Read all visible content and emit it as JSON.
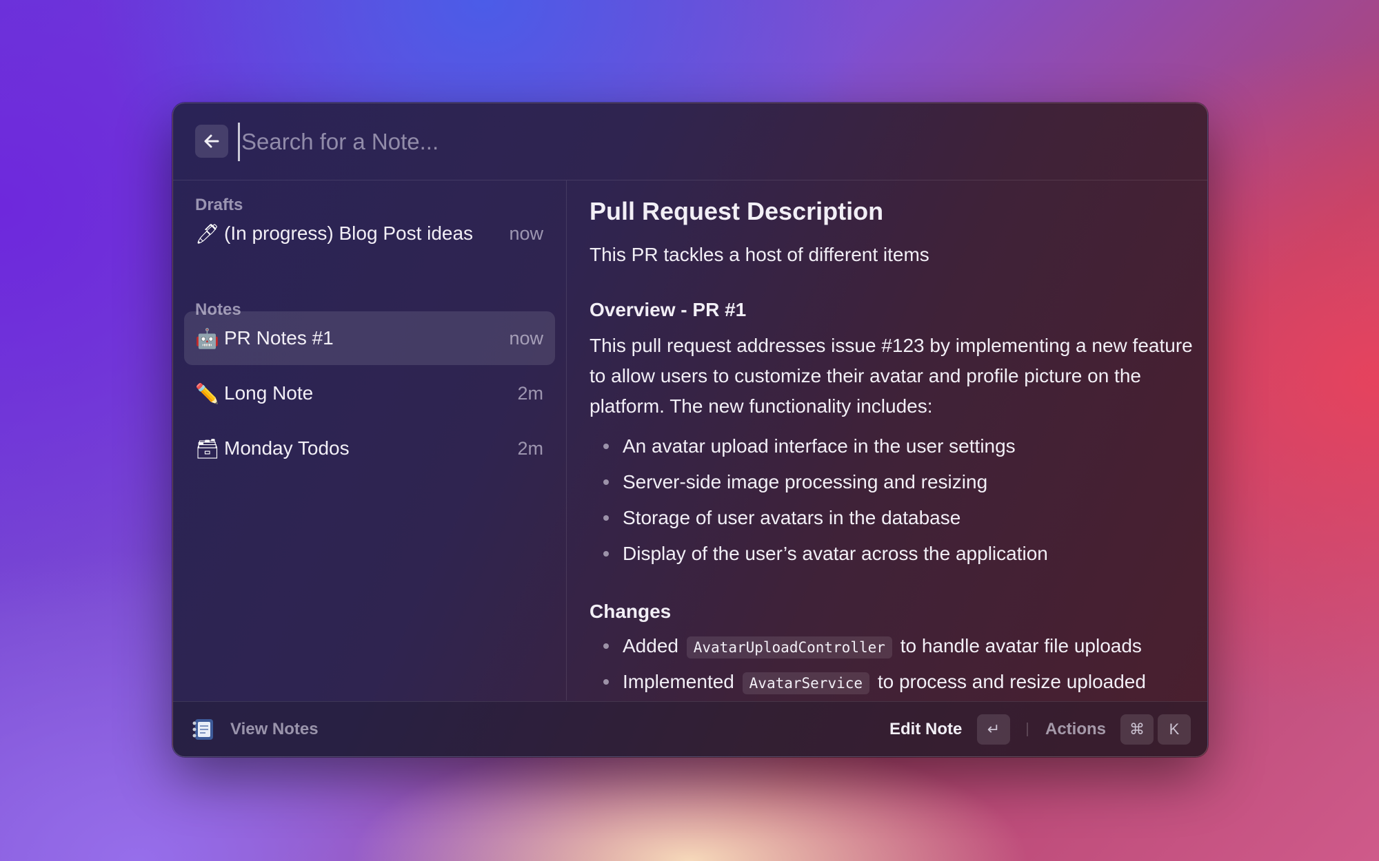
{
  "search": {
    "placeholder": "Search for a Note...",
    "back_icon": "arrow-left-icon"
  },
  "sidebar": {
    "drafts_label": "Drafts",
    "drafts": [
      {
        "emoji": "🖊",
        "title": "(In progress) Blog Post ideas",
        "time": "now"
      }
    ],
    "notes_label": "Notes",
    "notes": [
      {
        "emoji": "🤖",
        "title": "PR Notes #1",
        "time": "now",
        "selected": true
      },
      {
        "emoji": "✏️",
        "title": "Long Note",
        "time": "2m"
      },
      {
        "emoji": "🗃",
        "title": "Monday Todos",
        "time": "2m"
      }
    ]
  },
  "detail": {
    "title": "Pull Request Description",
    "lead": "This PR tackles a host of different items",
    "overview_heading": "Overview - PR #1",
    "overview_text": "This pull request addresses issue #123 by implementing a new feature to allow users to customize their avatar and profile picture on the platform. The new functionality includes:",
    "overview_bullets": [
      "An avatar upload interface in the user settings",
      "Server-side image processing and resizing",
      "Storage of user avatars in the database",
      "Display of the user’s avatar across the application"
    ],
    "changes_heading": "Changes",
    "changes": [
      {
        "before": "Added",
        "code": "AvatarUploadController",
        "after": "to handle avatar file uploads"
      },
      {
        "before": "Implemented",
        "code": "AvatarService",
        "after": "to process and resize uploaded"
      }
    ]
  },
  "footer": {
    "view_notes": "View Notes",
    "edit_note": "Edit Note",
    "enter_key": "↵",
    "actions": "Actions",
    "cmd_key": "⌘",
    "k_key": "K"
  }
}
